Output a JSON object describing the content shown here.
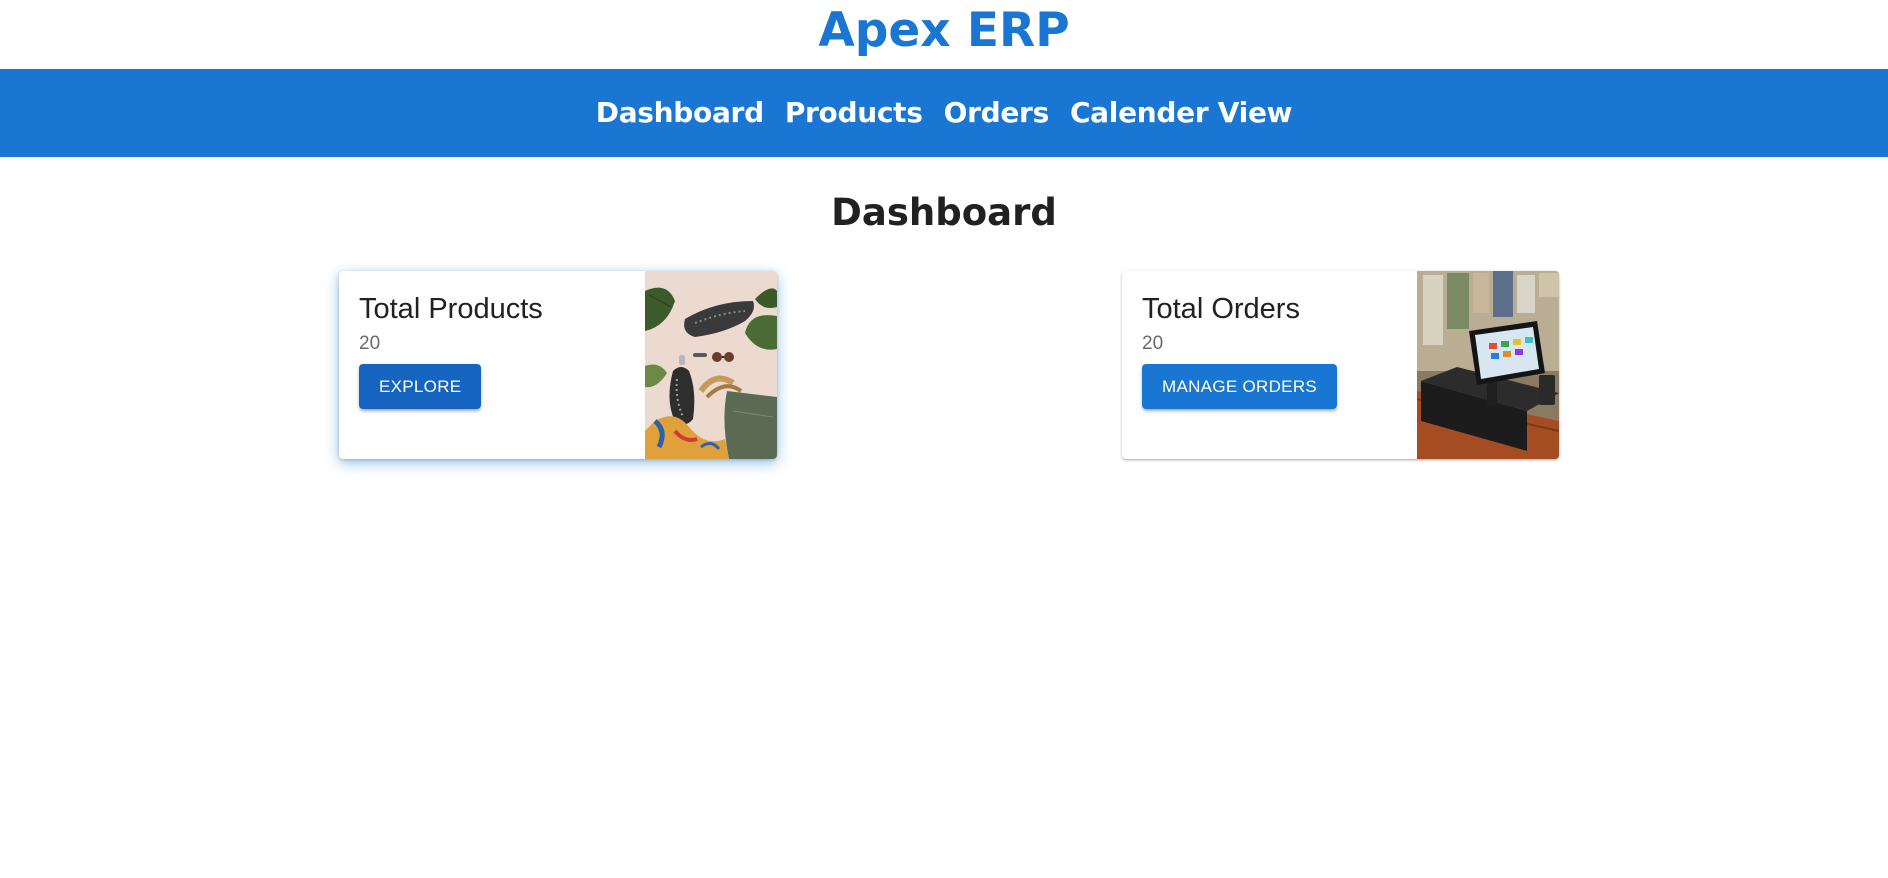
{
  "app": {
    "title": "Apex ERP"
  },
  "nav": {
    "items": [
      {
        "label": "Dashboard"
      },
      {
        "label": "Products"
      },
      {
        "label": "Orders"
      },
      {
        "label": "Calender View"
      }
    ]
  },
  "page": {
    "title": "Dashboard"
  },
  "cards": [
    {
      "title": "Total Products",
      "count": "20",
      "button_label": "EXPLORE",
      "image": "fashion-accessories-photo"
    },
    {
      "title": "Total Orders",
      "count": "20",
      "button_label": "MANAGE ORDERS",
      "image": "pos-terminal-photo"
    }
  ],
  "colors": {
    "primary": "#1976d2",
    "button_dark": "#1565c0",
    "text": "#212121",
    "secondary_text": "#6b6b6b"
  }
}
